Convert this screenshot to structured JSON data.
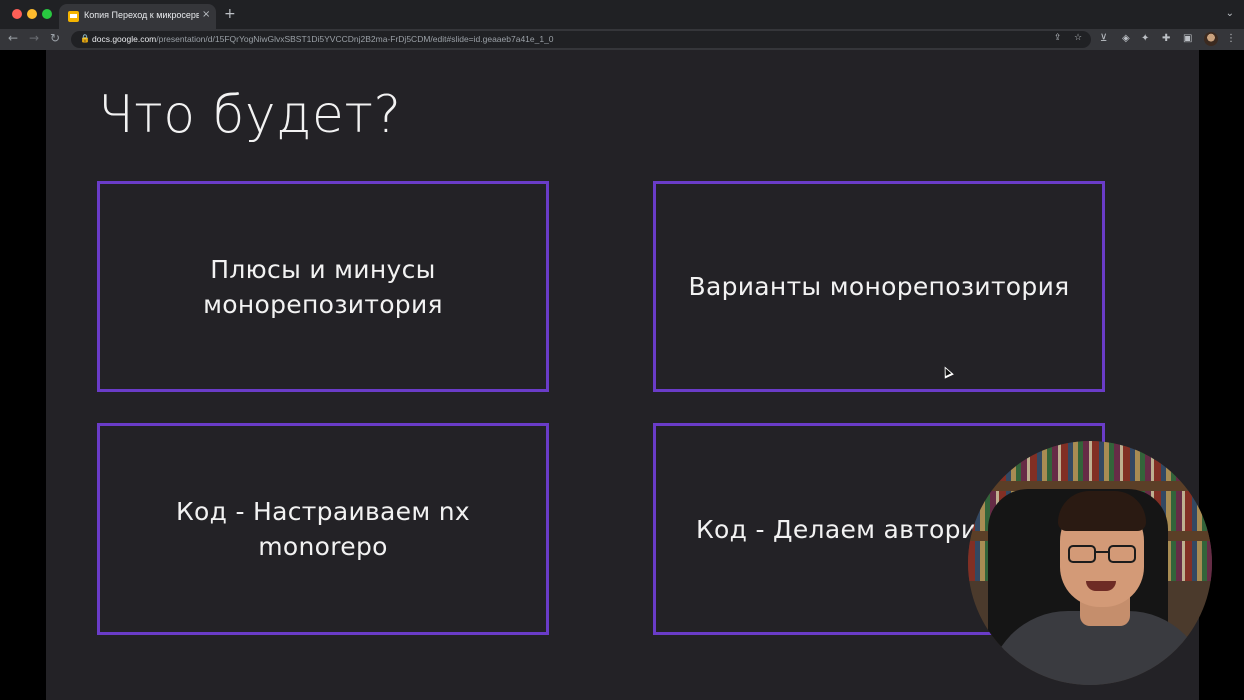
{
  "browser": {
    "tab_title": "Копия Переход к микросерв",
    "tab_close": "×",
    "new_tab": "+",
    "tabs_menu": "⌄",
    "url_host": "docs.google.com",
    "url_path": "/presentation/d/15FQrYogNiwGlvxSBST1Di5YVCCDnj2B2ma-FrDj5CDM/edit#slide=id.geaaeb7a41e_1_0",
    "back": "←",
    "forward": "→",
    "reload": "↻"
  },
  "slide": {
    "title": "Что будет?",
    "cards": [
      {
        "line1": "Плюсы и минусы",
        "line2": "монорепозитория"
      },
      {
        "line1": "Варианты монорепозитория",
        "line2": ""
      },
      {
        "line1": "Код - Настраиваем nx",
        "line2": "monorepo"
      },
      {
        "line1": "Код - Делаем автори",
        "line2": ""
      }
    ]
  },
  "colors": {
    "slide_bg": "#232226",
    "card_border": "#6a3cc8",
    "text": "#f2f2f2"
  }
}
